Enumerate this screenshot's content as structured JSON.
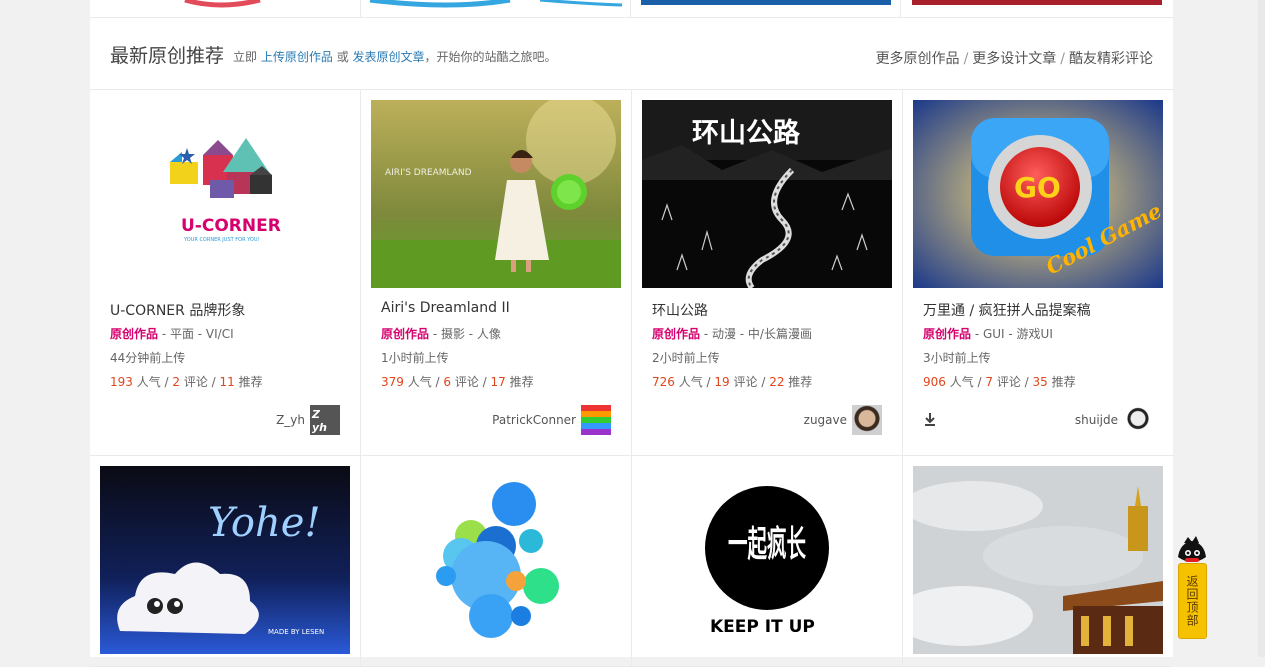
{
  "section": {
    "title": "最新原创推荐",
    "desc_prefix": "立即",
    "upload_link": "上传原创作品",
    "or": "或",
    "article_link": "发表原创文章",
    "desc_suffix": "，开始你的站酷之旅吧。",
    "more": [
      "更多原创作品",
      "更多设计文章",
      "酷友精彩评论"
    ],
    "sep": "/"
  },
  "cards": [
    {
      "title": "U-CORNER 品牌形象",
      "orig": "原创作品",
      "cat": " - 平面 - VI/CI",
      "time": "44分钟前上传",
      "views": "193",
      "views_l": " 人气 / ",
      "comments": "2",
      "comments_l": " 评论 / ",
      "recs": "11",
      "recs_l": " 推荐",
      "author": "Z_yh",
      "logo_name": "U-CORNER",
      "logo_tag": "YOUR CORNER JUST FOR YOU!",
      "avatar_text": "Z yh"
    },
    {
      "title": "Airi's Dreamland II",
      "orig": "原创作品",
      "cat": " - 摄影 - 人像",
      "time": "1小时前上传",
      "views": "379",
      "views_l": " 人气 / ",
      "comments": "6",
      "comments_l": " 评论 / ",
      "recs": "17",
      "recs_l": " 推荐",
      "author": "PatrickConner",
      "photo_text": "AIRI'S DREAMLAND"
    },
    {
      "title": "环山公路",
      "orig": "原创作品",
      "cat": " - 动漫 - 中/长篇漫画",
      "time": "2小时前上传",
      "views": "726",
      "views_l": " 人气 / ",
      "comments": "19",
      "comments_l": " 评论 / ",
      "recs": "22",
      "recs_l": " 推荐",
      "author": "zugave",
      "art_text": "环山公路"
    },
    {
      "title": "万里通 / 疯狂拼人品提案稿",
      "orig": "原创作品",
      "cat": " - GUI - 游戏UI",
      "time": "3小时前上传",
      "views": "906",
      "views_l": " 人气 / ",
      "comments": "7",
      "comments_l": " 评论 / ",
      "recs": "35",
      "recs_l": " 推荐",
      "author": "shuijde",
      "go_text": "GO",
      "game_text": "Cool Game"
    }
  ],
  "row2": {
    "yohe_text": "Yohe!",
    "yohe_sub": "MADE BY LESEN",
    "keep_big": "一起疯长",
    "keep_text": "KEEP IT UP"
  },
  "back_to_top": "返回顶部",
  "colors": {
    "accent": "#d6006e",
    "stat": "#e0451b",
    "link": "#2a7bb5",
    "top_btn": "#f6c200"
  }
}
